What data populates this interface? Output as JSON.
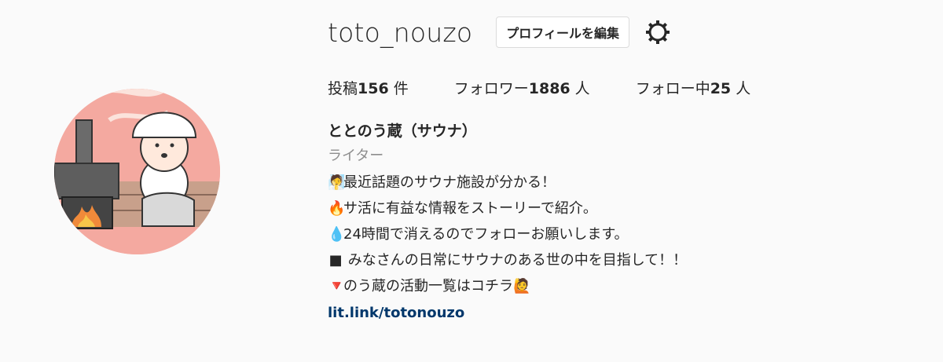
{
  "profile": {
    "username": "toto_nouzo",
    "edit_button": "プロフィールを編集",
    "settings_icon": "gear-icon"
  },
  "stats": {
    "posts_label": "投稿",
    "posts_count": "156",
    "posts_unit": " 件",
    "followers_label": "フォロワー",
    "followers_count": "1886",
    "followers_unit": " 人",
    "following_label": "フォロー中",
    "following_count": "25",
    "following_unit": " 人"
  },
  "bio": {
    "full_name": "ととのう蔵（サウナ）",
    "category": "ライター",
    "lines": [
      {
        "emoji": "🧖",
        "text": "最近話題のサウナ施設が分かる！"
      },
      {
        "emoji": "🔥",
        "text": "サ活に有益な情報をストーリーで紹介。"
      },
      {
        "emoji": "💧",
        "text": "24時間で消えるのでフォローお願いします。"
      },
      {
        "emoji": "■",
        "text": " みなさんの日常にサウナのある世の中を目指して！！"
      },
      {
        "emoji": "🔻",
        "text": "のう蔵の活動一覧はコチラ🙋"
      }
    ],
    "link": "lit.link/totonouzo"
  },
  "colors": {
    "link": "#00376b",
    "muted": "#8e8e8e",
    "avatar_bg": "#f4a9a0"
  }
}
